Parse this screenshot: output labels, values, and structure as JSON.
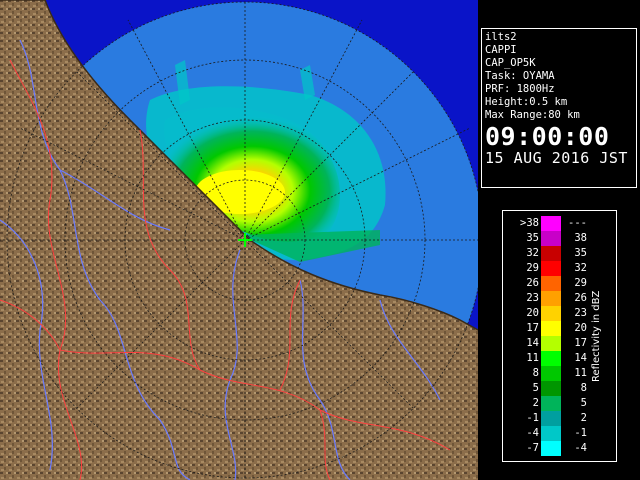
{
  "info_panel": {
    "lines": [
      "ilts2",
      "CAPPI",
      "CAP_OP5K",
      "Task: OYAMA",
      "PRF: 1800Hz",
      "Height:0.5 km",
      "Max Range:80 km"
    ],
    "time": "09:00:00",
    "date": "15 AUG 2016 JST"
  },
  "legend": {
    "unit_label": "Reflectivity in dBZ",
    "rows": [
      {
        "lo": ">38",
        "hi": "---",
        "color": "#ff00ff"
      },
      {
        "lo": "35",
        "hi": "38",
        "color": "#c800c8"
      },
      {
        "lo": "32",
        "hi": "35",
        "color": "#c80000"
      },
      {
        "lo": "29",
        "hi": "32",
        "color": "#ff0000"
      },
      {
        "lo": "26",
        "hi": "29",
        "color": "#ff6400"
      },
      {
        "lo": "23",
        "hi": "26",
        "color": "#ffa000"
      },
      {
        "lo": "20",
        "hi": "23",
        "color": "#ffd200"
      },
      {
        "lo": "17",
        "hi": "20",
        "color": "#ffff00"
      },
      {
        "lo": "14",
        "hi": "17",
        "color": "#b4ff00"
      },
      {
        "lo": "11",
        "hi": "14",
        "color": "#00ff00"
      },
      {
        "lo": "8",
        "hi": "11",
        "color": "#00c800"
      },
      {
        "lo": "5",
        "hi": "8",
        "color": "#009600"
      },
      {
        "lo": "2",
        "hi": "5",
        "color": "#00b45a"
      },
      {
        "lo": "-1",
        "hi": "2",
        "color": "#009f9f"
      },
      {
        "lo": "-4",
        "hi": "-1",
        "color": "#00c8c8"
      },
      {
        "lo": "-7",
        "hi": "-4",
        "color": "#00ffff"
      }
    ]
  },
  "map_colors": {
    "land": "#8b6d4a",
    "land_dark": "#4a3a25",
    "sea_range": "#2a7be0",
    "sea_outside": "#0a14c8",
    "rivers": "#6a7bff",
    "borders": "#ff4040",
    "range_rings": "#1a1a1a"
  }
}
